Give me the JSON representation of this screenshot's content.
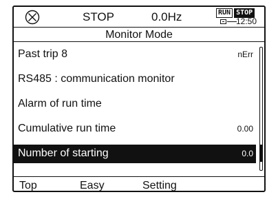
{
  "status_bar": {
    "stop_icon": "circle-x-icon",
    "state": "STOP",
    "frequency": "0.0Hz",
    "run_indicator": "RUN",
    "stop_indicator": "STOP",
    "clock_icon": "battery-icon",
    "time": "12:50"
  },
  "title": "Monitor Mode",
  "items": [
    {
      "label": "Past trip 8",
      "value": "nErr"
    },
    {
      "label": "RS485 : communication monitor",
      "value": ""
    },
    {
      "label": "Alarm of run time",
      "value": ""
    },
    {
      "label": "Cumulative run time",
      "value": "0.00"
    },
    {
      "label": "Number of starting",
      "value": "0.0",
      "selected": true
    }
  ],
  "scroll": {
    "position": 0.92,
    "thumb_fraction": 0.14
  },
  "softkeys": [
    "Top",
    "Easy",
    "Setting"
  ],
  "colors": {
    "foreground": "#111111",
    "background": "#ffffff",
    "selection": "#111111"
  }
}
